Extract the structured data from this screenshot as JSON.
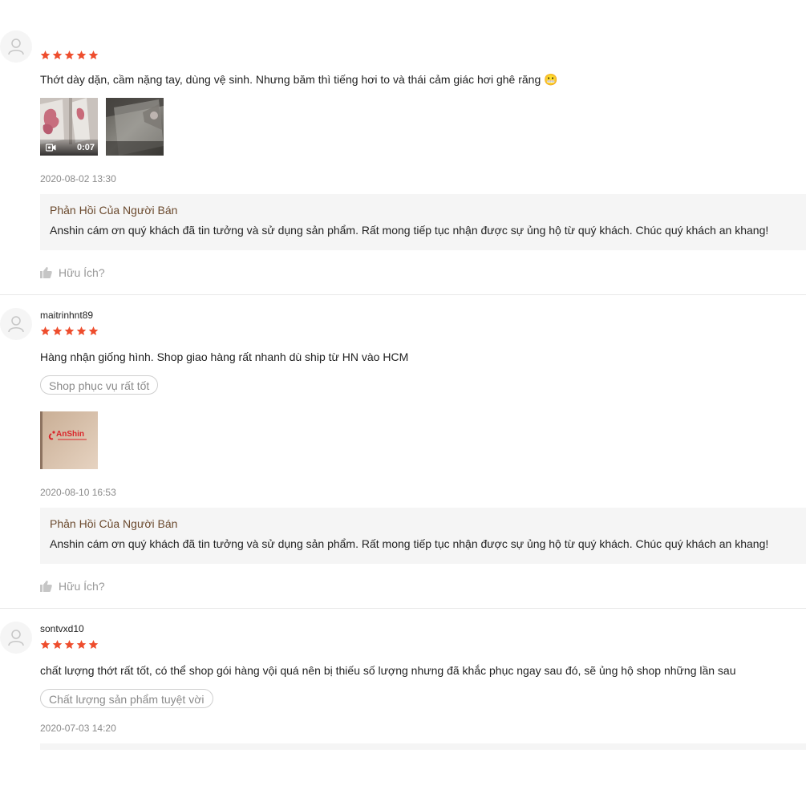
{
  "colors": {
    "star": "#ee4d2d",
    "seller_title": "#6b4a2e",
    "muted": "#8a8a8a",
    "reply_bg": "#f5f5f5"
  },
  "reviews": [
    {
      "username": "",
      "rating": 5,
      "text": "Thớt dày dặn, cầm nặng tay, dùng vệ sinh. Nhưng băm thì tiếng hơi to và thái cảm giác hơi ghê răng 😬",
      "media": [
        {
          "type": "video",
          "icon": "video-camera-icon",
          "duration": "0:07"
        },
        {
          "type": "image"
        }
      ],
      "timestamp": "2020-08-02 13:30",
      "seller_reply": {
        "title": "Phản Hồi Của Người Bán",
        "text": "Anshin cám ơn quý khách đã tin tưởng và sử dụng sản phẩm. Rất mong tiếp tục nhận được sự ủng hộ từ quý khách. Chúc quý khách an khang!"
      },
      "helpful_label": "Hữu Ích?"
    },
    {
      "username": "maitrinhnt89",
      "rating": 5,
      "text": "Hàng nhận giống hình. Shop giao hàng rất nhanh dù ship từ HN vào HCM",
      "tag": "Shop phục vụ rất tốt",
      "media": [
        {
          "type": "image",
          "logo_text": "AnShin"
        }
      ],
      "timestamp": "2020-08-10 16:53",
      "seller_reply": {
        "title": "Phản Hồi Của Người Bán",
        "text": "Anshin cám ơn quý khách đã tin tưởng và sử dụng sản phẩm. Rất mong tiếp tục nhận được sự ủng hộ từ quý khách. Chúc quý khách an khang!"
      },
      "helpful_label": "Hữu Ích?"
    },
    {
      "username": "sontvxd10",
      "rating": 5,
      "text": "chất lượng thớt rất tốt, có thể shop gói hàng vội quá nên bị thiếu số lượng nhưng đã khắc phục ngay sau đó, sẽ ủng hộ shop những lần sau",
      "tag": "Chất lượng sản phẩm tuyệt vời",
      "timestamp": "2020-07-03 14:20"
    }
  ]
}
